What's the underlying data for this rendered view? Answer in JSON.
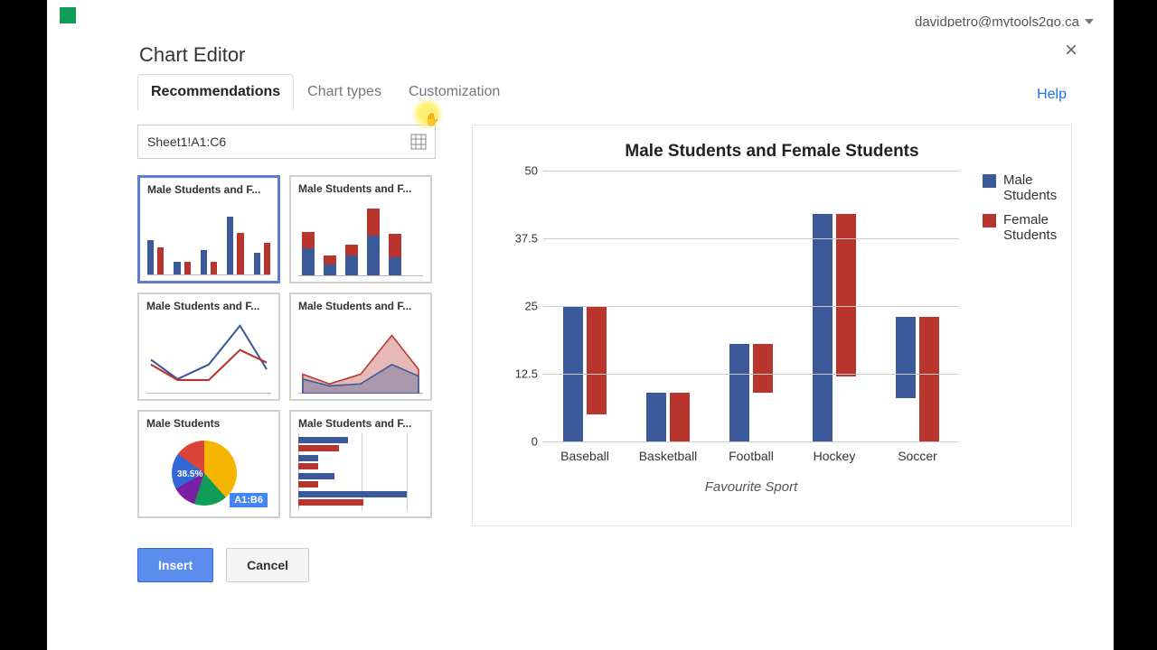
{
  "account": {
    "email": "davidpetro@mytools2go.ca"
  },
  "dialog": {
    "title": "Chart Editor",
    "tabs": {
      "recommendations": "Recommendations",
      "chart_types": "Chart types",
      "customization": "Customization"
    },
    "help_label": "Help",
    "range_value": "Sheet1!A1:C6",
    "insert_label": "Insert",
    "cancel_label": "Cancel"
  },
  "thumbs": {
    "t1": "Male Students and F...",
    "t2": "Male Students and F...",
    "t3": "Male Students and F...",
    "t4": "Male Students and F...",
    "t5": "Male Students",
    "t5_pct": "38.5%",
    "t5_badge": "A1:B6",
    "t6": "Male Students and F..."
  },
  "colors": {
    "male": "#3b5998",
    "female": "#b7352d"
  },
  "chart_data": {
    "type": "bar",
    "title": "Male Students and Female Students",
    "xlabel": "Favourite Sport",
    "ylabel": "",
    "ylim": [
      0,
      50
    ],
    "yticks": [
      0,
      12.5,
      25,
      37.5,
      50
    ],
    "categories": [
      "Baseball",
      "Basketball",
      "Football",
      "Hockey",
      "Soccer"
    ],
    "series": [
      {
        "name": "Male Students",
        "values": [
          25,
          9,
          18,
          42,
          15
        ]
      },
      {
        "name": "Female Students",
        "values": [
          20,
          9,
          9,
          30,
          23
        ]
      }
    ],
    "legend": [
      "Male Students",
      "Female Students"
    ]
  }
}
